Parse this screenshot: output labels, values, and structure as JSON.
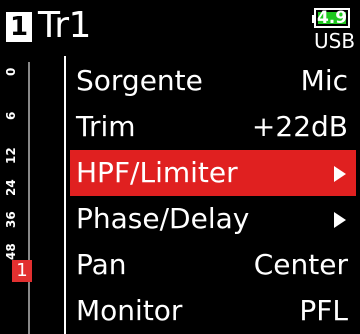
{
  "header": {
    "track_number": "1",
    "track_name": "Tr1",
    "battery": {
      "value": "4.9",
      "source": "USB",
      "fill_color": "#1fc81f"
    }
  },
  "meter": {
    "ticks": [
      "0",
      "6",
      "12",
      "24",
      "36",
      "48"
    ],
    "track_badge": "1",
    "badge_color": "#e23030"
  },
  "menu": {
    "items": [
      {
        "label": "Sorgente",
        "value": "Mic",
        "selected": false
      },
      {
        "label": "Trim",
        "value": "+22dB",
        "selected": false
      },
      {
        "label": "HPF/Limiter",
        "value": "",
        "has_submenu": true,
        "selected": true
      },
      {
        "label": "Phase/Delay",
        "value": "",
        "has_submenu": true,
        "selected": false
      },
      {
        "label": "Pan",
        "value": "Center",
        "selected": false
      },
      {
        "label": "Monitor",
        "value": "PFL",
        "selected": false
      }
    ],
    "highlight_color": "#e02020"
  }
}
